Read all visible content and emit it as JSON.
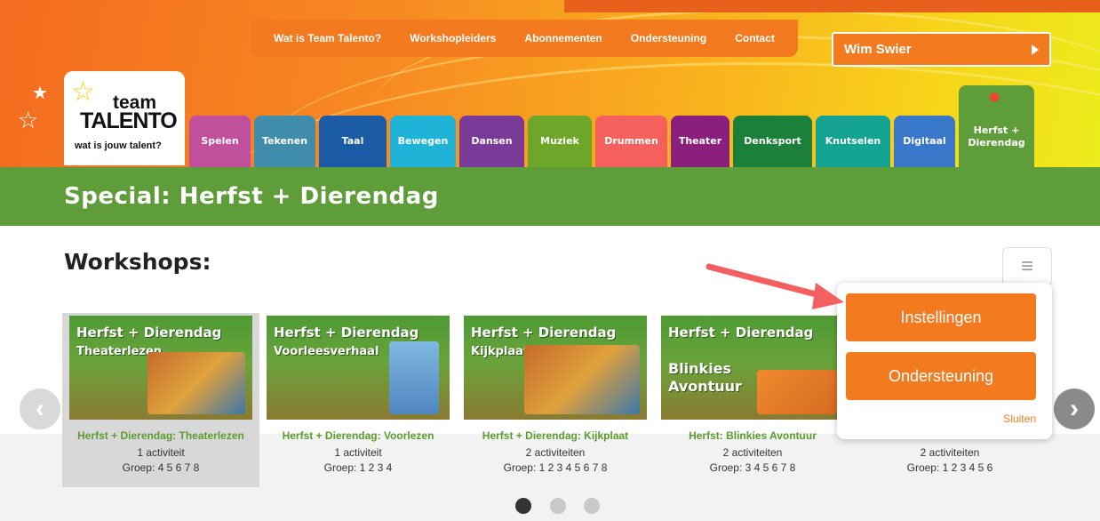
{
  "topnav": [
    "Wat is Team Talento?",
    "Workshopleiders",
    "Abonnementen",
    "Ondersteuning",
    "Contact"
  ],
  "user": {
    "name": "Wim Swier"
  },
  "logo": {
    "line1": "team",
    "line2": "TALENTO",
    "tagline": "wat is jouw talent?"
  },
  "tabs": [
    {
      "label": "Spelen",
      "color": "#c04f9c"
    },
    {
      "label": "Tekenen",
      "color": "#3f8cab"
    },
    {
      "label": "Taal",
      "color": "#1b5aa5"
    },
    {
      "label": "Bewegen",
      "color": "#1fb3d8"
    },
    {
      "label": "Dansen",
      "color": "#7a3b98"
    },
    {
      "label": "Muziek",
      "color": "#6ea62a"
    },
    {
      "label": "Drummen",
      "color": "#f4605b"
    },
    {
      "label": "Theater",
      "color": "#8a1f7d"
    },
    {
      "label": "Denksport",
      "color": "#1c7f3a"
    },
    {
      "label": "Knutselen",
      "color": "#14a393"
    },
    {
      "label": "Digitaal",
      "color": "#3977c9"
    },
    {
      "label": "Herfst + Dierendag",
      "color": "#5f9d3b"
    }
  ],
  "special_title": "Special: Herfst + Dierendag",
  "workshops_title": "Workshops:",
  "cards": [
    {
      "thumb_title": "Herfst + Dierendag",
      "thumb_sub": "Theaterlezen",
      "name": "Herfst + Dierendag: Theaterlezen",
      "activities": "1 activiteit",
      "group": "Groep: 4 5 6 7 8"
    },
    {
      "thumb_title": "Herfst + Dierendag",
      "thumb_sub": "Voorleesverhaal",
      "name": "Herfst + Dierendag: Voorlezen",
      "activities": "1 activiteit",
      "group": "Groep: 1 2 3 4"
    },
    {
      "thumb_title": "Herfst + Dierendag",
      "thumb_sub": "Kijkplaat",
      "name": "Herfst + Dierendag: Kijkplaat",
      "activities": "2 activiteiten",
      "group": "Groep: 1 2 3 4 5 6 7 8"
    },
    {
      "thumb_title": "Herfst + Dierendag",
      "thumb_sub": "Blinkies Avontuur",
      "name": "Herfst: Blinkies Avontuur",
      "activities": "2 activiteiten",
      "group": "Groep: 3 4 5 6 7 8"
    },
    {
      "thumb_title": "",
      "thumb_sub": "",
      "name": "",
      "activities": "2 activiteiten",
      "group": "Groep: 1 2 3 4 5 6"
    }
  ],
  "menu": {
    "settings": "Instellingen",
    "support": "Ondersteuning",
    "close": "Sluiten"
  },
  "carousel": {
    "pages": 3,
    "active": 1
  },
  "colors": {
    "accent": "#f47a20",
    "green": "#5f9d3b",
    "card_title": "#5c9b2f"
  }
}
